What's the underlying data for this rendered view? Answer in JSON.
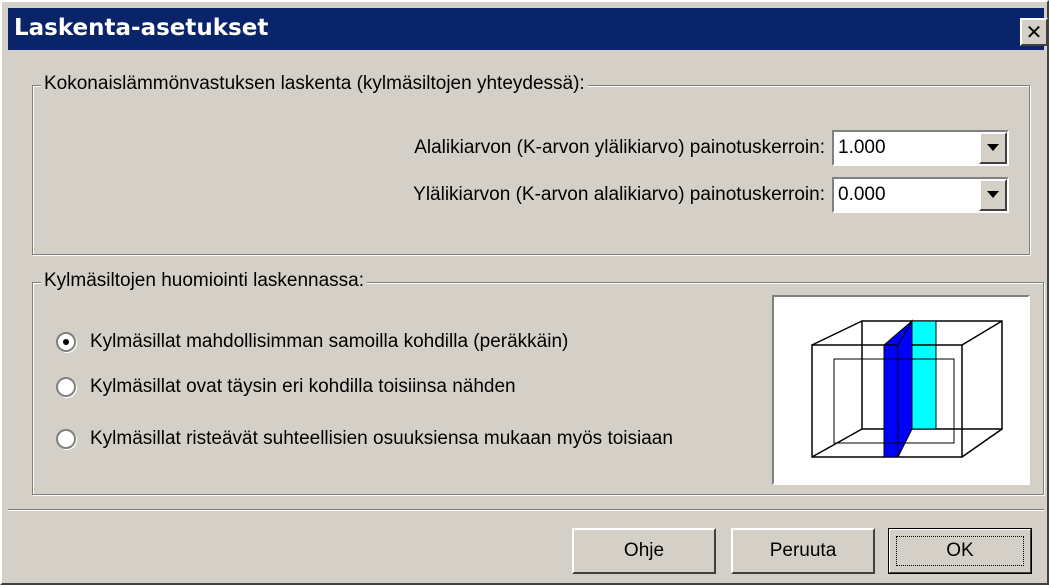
{
  "window": {
    "title": "Laskenta-asetukset",
    "close_glyph": "✕"
  },
  "group_resistance": {
    "legend": "Kokonaislämmönvastuksen laskenta (kylmäsiltojen yhteydessä):",
    "lower_label": "Alalikiarvon (K-arvon ylälikiarvo) painotuskerroin:",
    "lower_value": "1.000",
    "upper_label": "Ylälikiarvon (K-arvon alalikiarvo) painotuskerroin:",
    "upper_value": "0.000"
  },
  "group_bridges": {
    "legend": "Kylmäsiltojen huomiointi laskennassa:",
    "options": [
      {
        "label": "Kylmäsillat mahdollisimman samoilla kohdilla (peräkkäin)",
        "selected": true
      },
      {
        "label": "Kylmäsillat ovat täysin eri kohdilla toisiinsa nähden",
        "selected": false
      },
      {
        "label": "Kylmäsillat risteävät suhteellisien osuuksiensa mukaan myös toisiaan",
        "selected": false
      }
    ],
    "preview_colors": {
      "front": "#0000ff",
      "back": "#00ffff"
    }
  },
  "buttons": {
    "help": "Ohje",
    "cancel": "Peruuta",
    "ok": "OK"
  },
  "icons": {
    "dropdown": "triangle-down-icon"
  }
}
